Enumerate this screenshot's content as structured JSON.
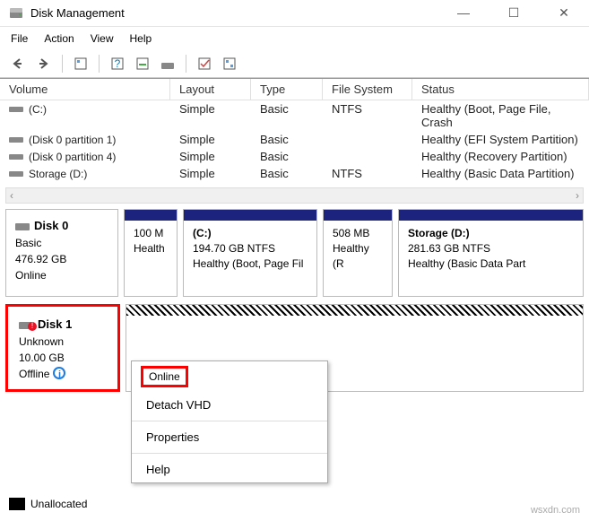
{
  "window": {
    "title": "Disk Management"
  },
  "menu": {
    "file": "File",
    "action": "Action",
    "view": "View",
    "help": "Help"
  },
  "columns": {
    "volume": "Volume",
    "layout": "Layout",
    "type": "Type",
    "fs": "File System",
    "status": "Status"
  },
  "volumes": [
    {
      "name": "(C:)",
      "layout": "Simple",
      "type": "Basic",
      "fs": "NTFS",
      "status": "Healthy (Boot, Page File, Crash"
    },
    {
      "name": "(Disk 0 partition 1)",
      "layout": "Simple",
      "type": "Basic",
      "fs": "",
      "status": "Healthy (EFI System Partition)"
    },
    {
      "name": "(Disk 0 partition 4)",
      "layout": "Simple",
      "type": "Basic",
      "fs": "",
      "status": "Healthy (Recovery Partition)"
    },
    {
      "name": "Storage (D:)",
      "layout": "Simple",
      "type": "Basic",
      "fs": "NTFS",
      "status": "Healthy (Basic Data Partition)"
    }
  ],
  "disk0": {
    "name": "Disk 0",
    "type": "Basic",
    "size": "476.92 GB",
    "state": "Online",
    "parts": [
      {
        "label": "",
        "size": "100 M",
        "status": "Health"
      },
      {
        "label": "(C:)",
        "size": "194.70 GB NTFS",
        "status": "Healthy (Boot, Page Fil"
      },
      {
        "label": "",
        "size": "508 MB",
        "status": "Healthy (R"
      },
      {
        "label": "Storage  (D:)",
        "size": "281.63 GB NTFS",
        "status": "Healthy (Basic Data Part"
      }
    ]
  },
  "disk1": {
    "name": "Disk 1",
    "type": "Unknown",
    "size": "10.00 GB",
    "state": "Offline"
  },
  "context": {
    "online": "Online",
    "detach": "Detach VHD",
    "properties": "Properties",
    "help": "Help"
  },
  "legend": {
    "unallocated": "Unallocated"
  },
  "watermark": "wsxdn.com"
}
